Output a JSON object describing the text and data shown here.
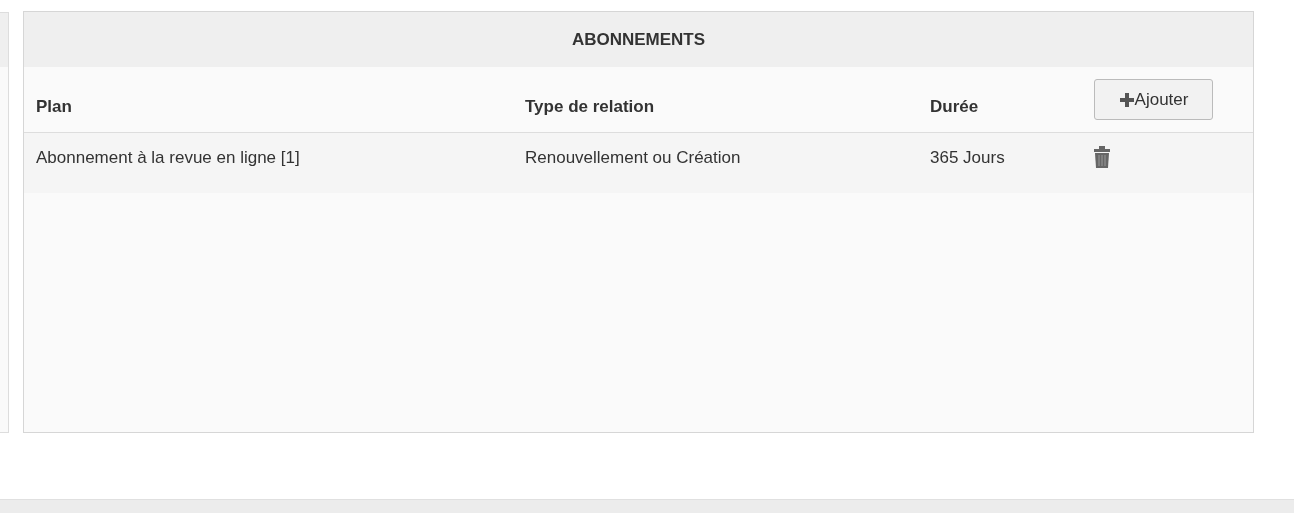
{
  "panel": {
    "title": "ABONNEMENTS"
  },
  "table": {
    "columns": [
      "Plan",
      "Type de relation",
      "Durée"
    ],
    "add_button": "Ajouter",
    "rows": [
      {
        "cells": [
          "Abonnement à la revue en ligne [1]",
          "Renouvellement ou Création",
          "365 Jours"
        ]
      }
    ]
  }
}
